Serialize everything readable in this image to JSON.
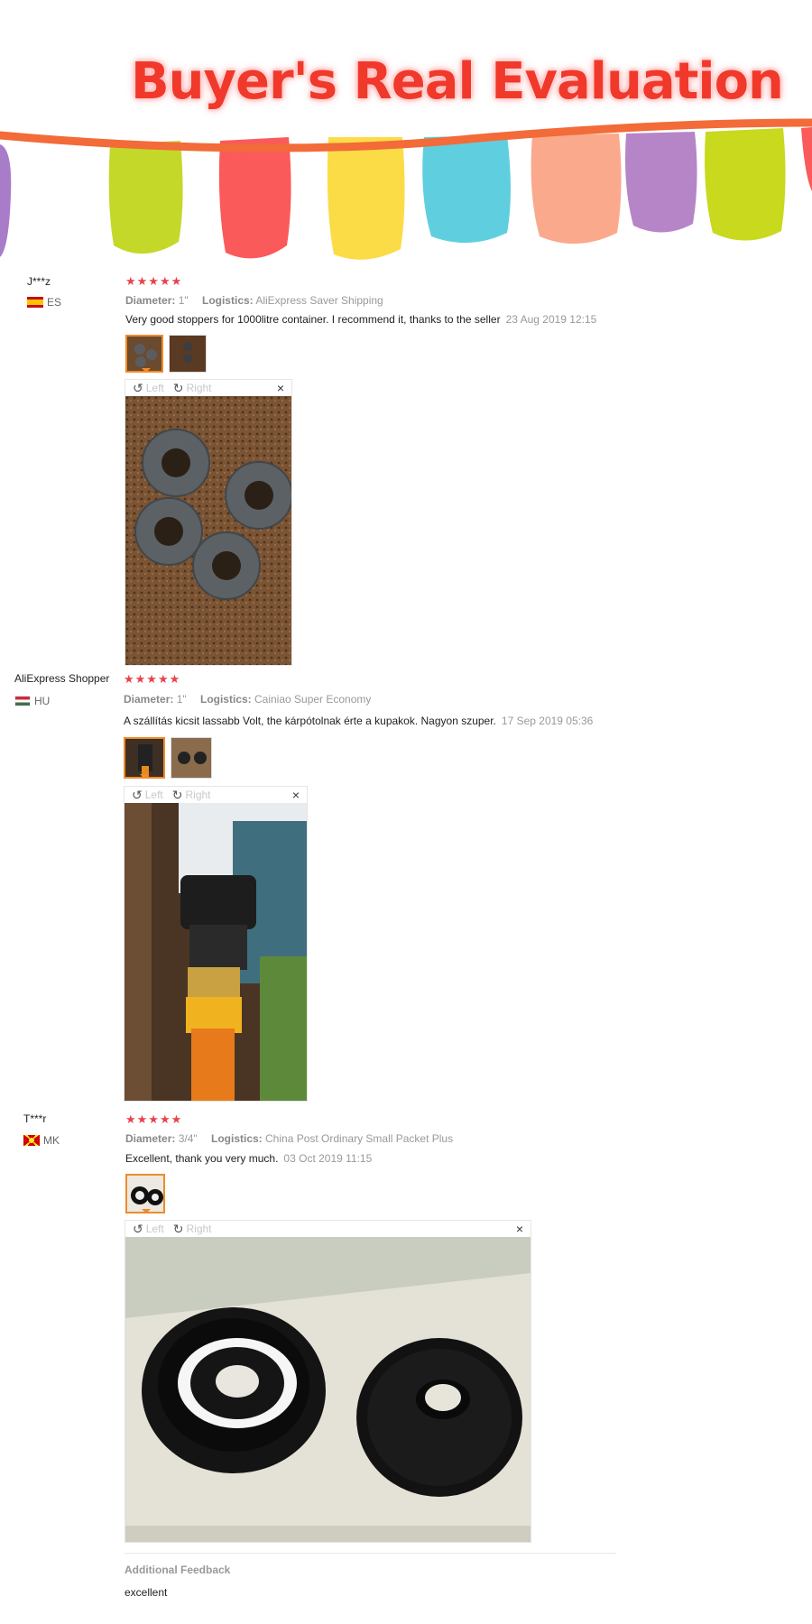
{
  "banner": {
    "title": "Buyer's Real Evaluation"
  },
  "reviews": [
    {
      "name": "J***z",
      "country": "ES",
      "rating": 5,
      "stars": "★★★★★",
      "diameter_label": "Diameter:",
      "diameter": "1\"",
      "logistics_label": "Logistics:",
      "logistics": "AliExpress Saver Shipping",
      "text": "Very good stoppers for 1000litre container. I recommend it, thanks to the seller",
      "date": "23 Aug 2019 12:15",
      "viewer": {
        "left": "Left",
        "right": "Right",
        "close": "×"
      }
    },
    {
      "name": "AliExpress Shopper",
      "country": "HU",
      "rating": 5,
      "stars": "★★★★★",
      "diameter_label": "Diameter:",
      "diameter": "1\"",
      "logistics_label": "Logistics:",
      "logistics": "Cainiao Super Economy",
      "text": "A szállítás kicsit lassabb Volt, the kárpótolnak érte a kupakok. Nagyon szuper.",
      "date": "17 Sep 2019 05:36",
      "viewer": {
        "left": "Left",
        "right": "Right",
        "close": "×"
      }
    },
    {
      "name": "T***r",
      "country": "MK",
      "rating": 5,
      "stars": "★★★★★",
      "diameter_label": "Diameter:",
      "diameter": "3/4\"",
      "logistics_label": "Logistics:",
      "logistics": "China Post Ordinary Small Packet Plus",
      "text": "Excellent, thank you very much.",
      "date": "03 Oct 2019 11:15",
      "viewer": {
        "left": "Left",
        "right": "Right",
        "close": "×"
      }
    }
  ],
  "additional_feedback": {
    "title": "Additional Feedback",
    "text": "excellent"
  },
  "icons": {
    "rotate_left": "rotate-left-icon",
    "rotate_right": "rotate-right-icon",
    "close": "close-icon"
  },
  "colors": {
    "title_red": "#f0392b",
    "star_red": "#e8424b",
    "thumb_active": "#f08b2a",
    "garland": "#f26b38"
  }
}
